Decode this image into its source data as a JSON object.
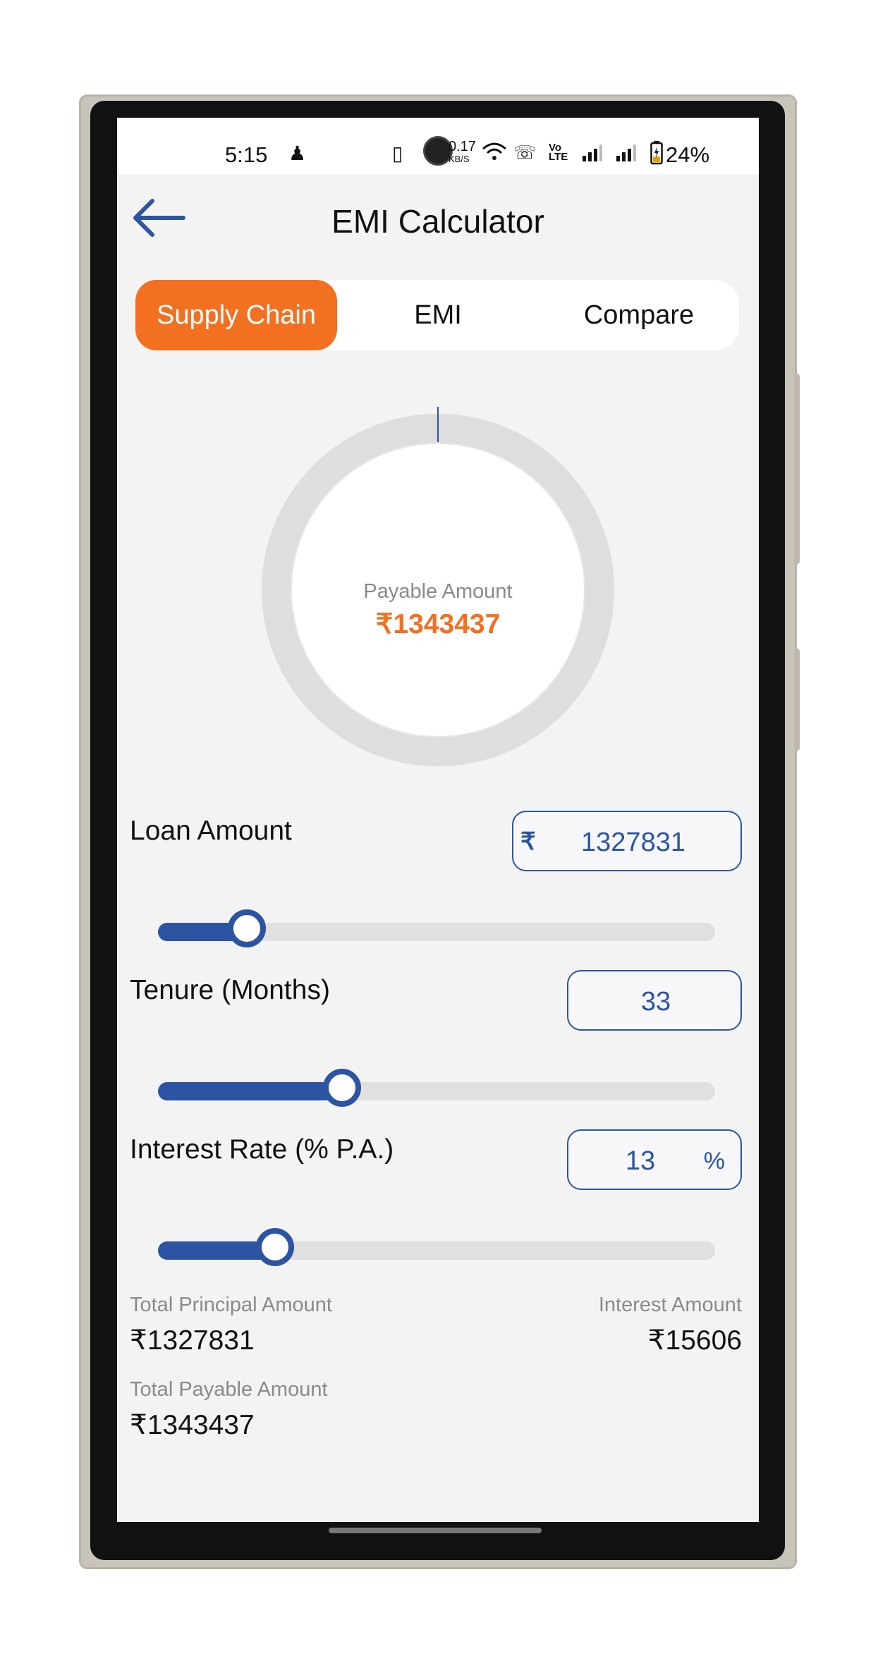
{
  "status_bar": {
    "time": "5:15",
    "network_speed": "0.17",
    "network_speed_unit": "KB/S",
    "battery": "24%",
    "icons": [
      "person-icon",
      "vibrate-icon",
      "wifi-icon",
      "wifi-call-icon",
      "volte-icon",
      "signal-icon",
      "signal-icon",
      "battery-charging-icon"
    ]
  },
  "header": {
    "title": "EMI Calculator",
    "back_icon": "arrow-left-icon"
  },
  "tabs": [
    {
      "label": "Supply Chain",
      "active": true
    },
    {
      "label": "EMI",
      "active": false
    },
    {
      "label": "Compare",
      "active": false
    }
  ],
  "donut": {
    "label": "Payable Amount",
    "value": "₹1343437",
    "principal_fraction": 0.9884,
    "interest_fraction": 0.0116
  },
  "loan_amount": {
    "label": "Loan Amount",
    "currency_symbol": "₹",
    "value": "1327831",
    "slider_fraction": 0.16
  },
  "tenure": {
    "label": "Tenure (Months)",
    "value": "33",
    "slider_fraction": 0.33
  },
  "interest_rate": {
    "label": "Interest Rate (% P.A.)",
    "value": "13",
    "unit": "%",
    "slider_fraction": 0.21
  },
  "summary": {
    "principal_label": "Total Principal Amount",
    "principal_value": "₹1327831",
    "interest_label": "Interest Amount",
    "interest_value": "₹15606",
    "payable_label": "Total Payable Amount",
    "payable_value": "₹1343437"
  },
  "colors": {
    "accent_orange": "#f37021",
    "primary_blue": "#2c54a3",
    "track_gray": "#e0e0e0",
    "background": "#f3f3f3"
  }
}
